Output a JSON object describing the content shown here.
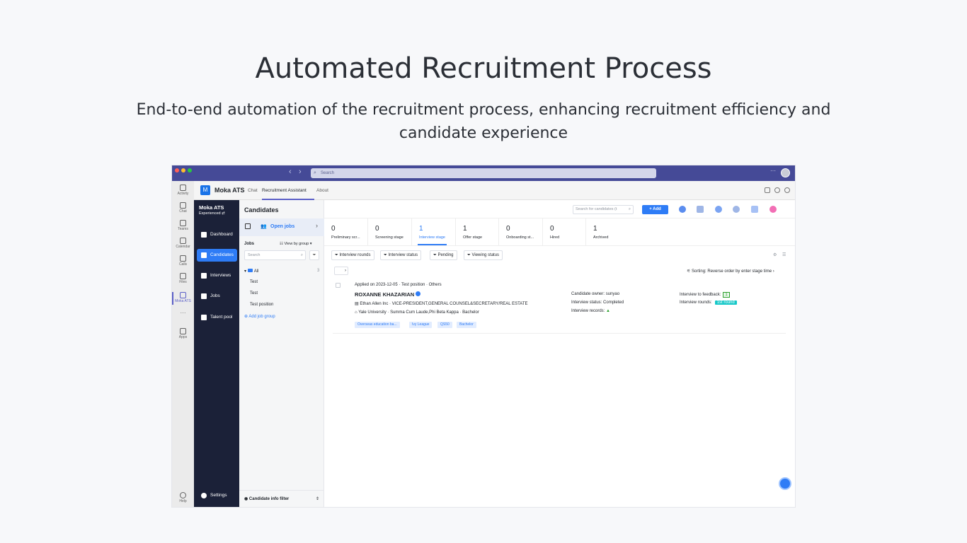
{
  "hero": {
    "title": "Automated Recruitment Process",
    "subtitle": "End-to-end automation of the recruitment process, enhancing recruitment efficiency and candidate experience"
  },
  "titlebar": {
    "search_placeholder": "Search",
    "more": "···"
  },
  "rail": {
    "items": [
      "Activity",
      "Chat",
      "Teams",
      "Calendar",
      "Calls",
      "Files",
      "Moka ATS",
      "···",
      "Apps",
      "Help"
    ]
  },
  "app": {
    "name": "Moka ATS",
    "tabs": [
      "Chat",
      "Recruitment Assistant",
      "About"
    ]
  },
  "sidebar": {
    "title": "Moka ATS",
    "subtitle": "Experienced",
    "items": [
      "Dashboard",
      "Candidates",
      "Interviews",
      "Jobs",
      "Talent pool"
    ],
    "settings": "Settings"
  },
  "jobs_panel": {
    "open_jobs": "Open jobs",
    "jobs_label": "Jobs",
    "view_by": "View by group",
    "search_placeholder": "Search",
    "all_label": "All",
    "all_count": "3",
    "jobs": [
      "Test",
      "Test",
      "Test position"
    ],
    "add_group": "Add job group",
    "candidate_filter": "Candidate info filter"
  },
  "main": {
    "title": "Candidates",
    "search_placeholder": "Search for candidates (t",
    "add_label": "Add",
    "stages": [
      {
        "count": "0",
        "label": "Preliminary scr..."
      },
      {
        "count": "0",
        "label": "Screening stage"
      },
      {
        "count": "1",
        "label": "Interview stage"
      },
      {
        "count": "1",
        "label": "Offer stage"
      },
      {
        "count": "0",
        "label": "Onboarding st..."
      },
      {
        "count": "0",
        "label": "Hired"
      },
      {
        "count": "1",
        "label": "Archived"
      }
    ],
    "filters": [
      "Interview rounds",
      "Interview status",
      "Pending",
      "Viewing status"
    ],
    "sorting": "Sorting: Reverse order by enter stage time"
  },
  "candidate": {
    "applied": "Applied on 2023-12-05 · Test position · Others",
    "name": "ROXANNE KHAZARIAN",
    "company": "Ethan Allen Inc · VICE-PRESIDENT,GENERAL COUNSEL&SECRETARY/REAL ESTATE",
    "education": "Yale University · Summa Cum Laude,Phi Beta Kappa · Bachelor",
    "tags": [
      "Overseas education ba...",
      "Ivy League",
      "QS50",
      "Bachelor"
    ],
    "owner_label": "Candidate owner:",
    "owner": "sunyao",
    "status_label": "Interview status:",
    "status": "Completed",
    "records_label": "Interview records:",
    "feedback_label": "Interview to feedback:",
    "feedback_count": "1",
    "rounds_label": "Interview rounds:",
    "round": "1st round"
  }
}
